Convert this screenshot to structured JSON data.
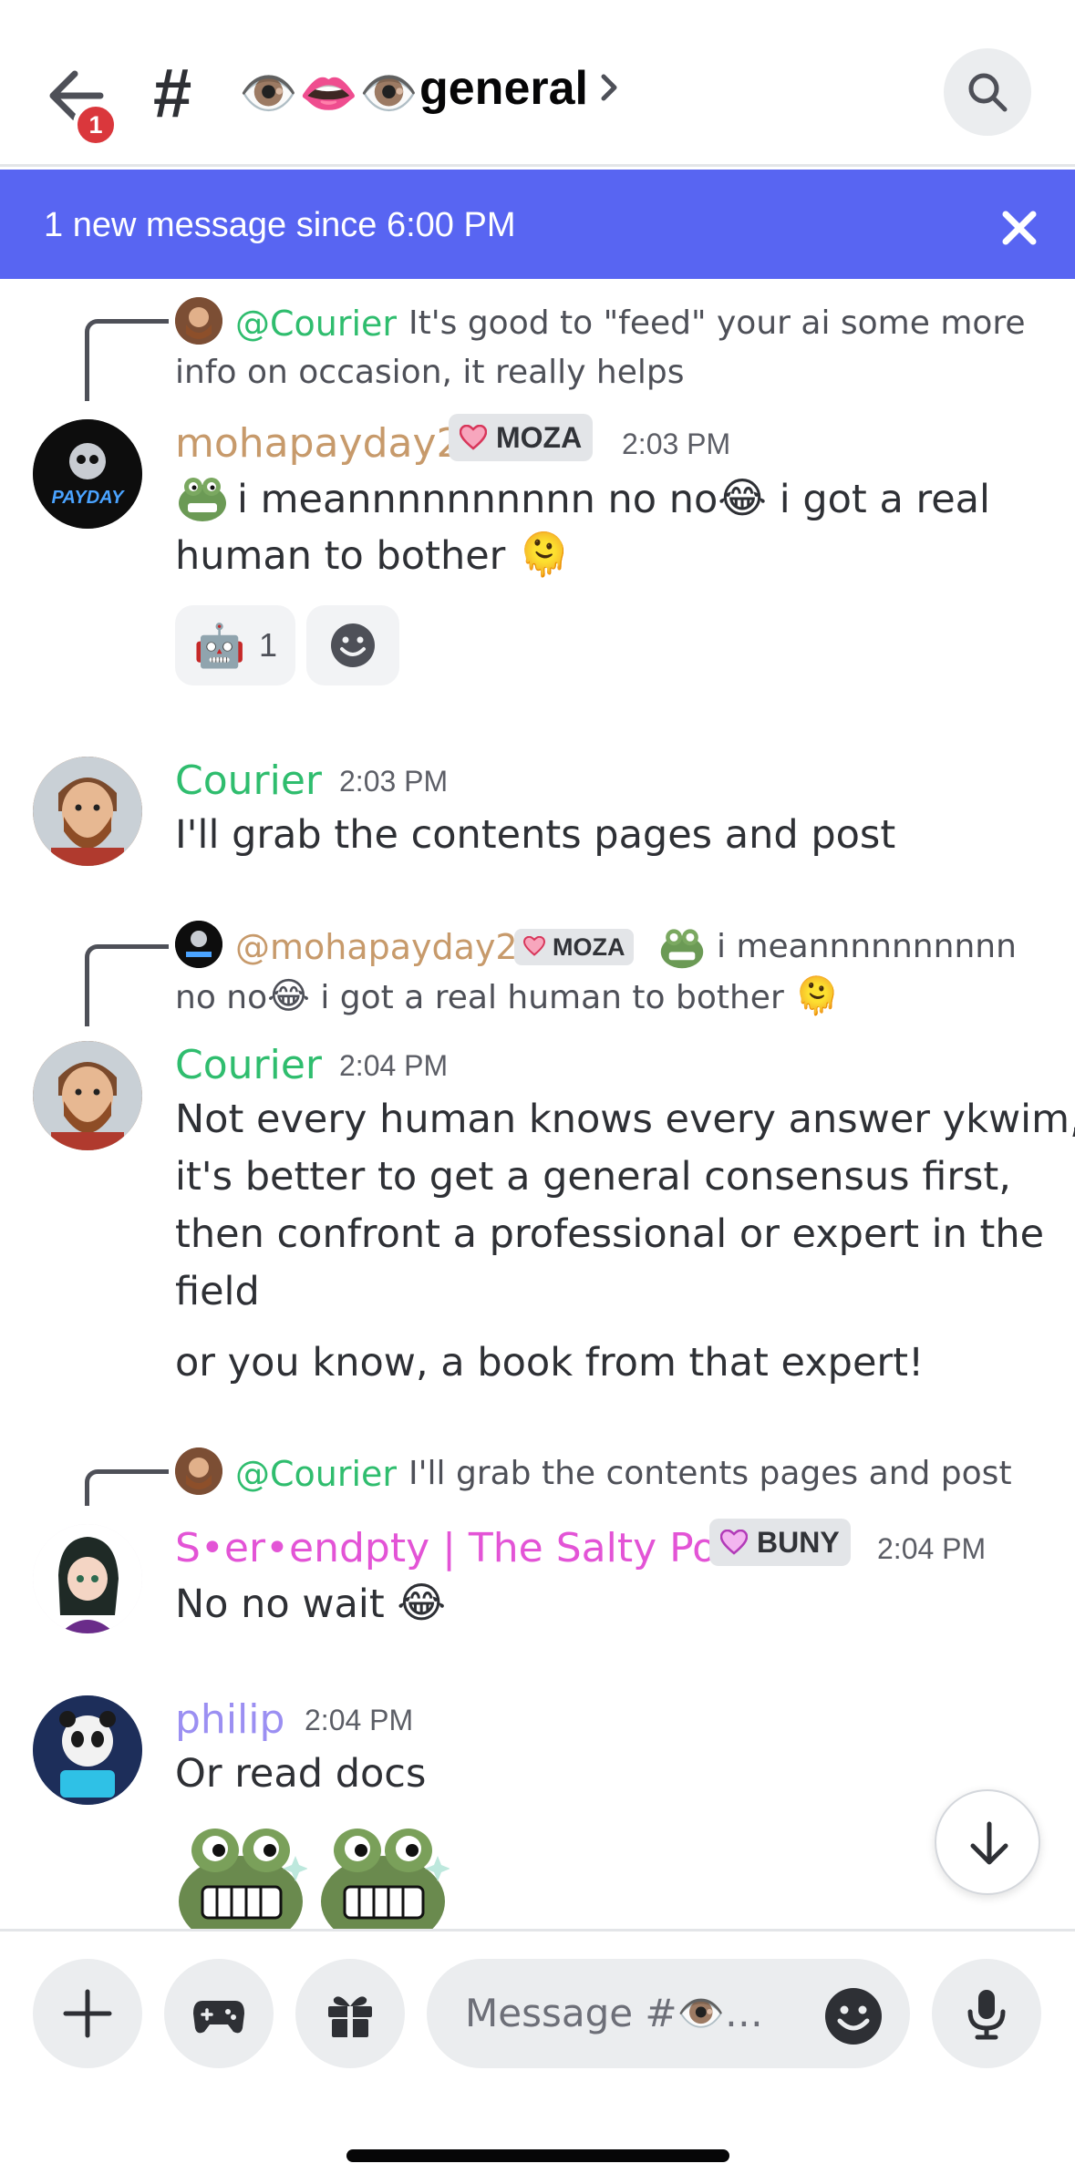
{
  "header": {
    "back_badge": "1",
    "channel_hash": "#",
    "channel_emoji": [
      "👁️",
      "👄",
      "👁️"
    ],
    "channel_name": "general"
  },
  "banner": {
    "text": "1 new message since 6:00 PM"
  },
  "messages": [
    {
      "reply": {
        "name": "@Courier",
        "text": "It's good to \"feed\" your ai some more",
        "text2": "info on occasion, it really helps"
      },
      "author": "mohapayday2",
      "tag": "MOZA",
      "time": "2:03 PM",
      "line1": "i meannnnnnnnnn no no",
      "line1b": " i got a real",
      "line2": "human to bother",
      "reactions": [
        {
          "emoji": "🤖",
          "count": "1"
        }
      ]
    },
    {
      "author": "Courier",
      "time": "2:03 PM",
      "line1": "I'll grab the contents pages and post"
    },
    {
      "reply": {
        "name": "@mohapayday2",
        "tag": "MOZA",
        "text": "i meannnnnnnnnn",
        "text2a": "no no",
        "text2b": " i got a real human to bother"
      },
      "author": "Courier",
      "time": "2:04 PM",
      "lines": [
        "Not every human knows every answer ykwim,",
        "it's better to get a general consensus first,",
        "then confront a professional or expert in the",
        "field"
      ],
      "extra": "or you know, a book from that expert!"
    },
    {
      "reply": {
        "name": "@Courier",
        "text": "I'll grab the contents pages and post"
      },
      "author": "S•er•endpty | The Salty Poet",
      "tag": "BUNY",
      "time": "2:04 PM",
      "line1": "No no wait"
    },
    {
      "author": "philip",
      "time": "2:04 PM",
      "line1": "Or read docs"
    }
  ],
  "composer": {
    "placeholder": "Message #👁️…"
  },
  "colors": {
    "accent": "#5865f2",
    "mohapayday2": "#c79a6b",
    "courier": "#2fbd6e",
    "serendpty": "#e354d6",
    "philip": "#9b8ff2",
    "badge": "#da373c"
  }
}
